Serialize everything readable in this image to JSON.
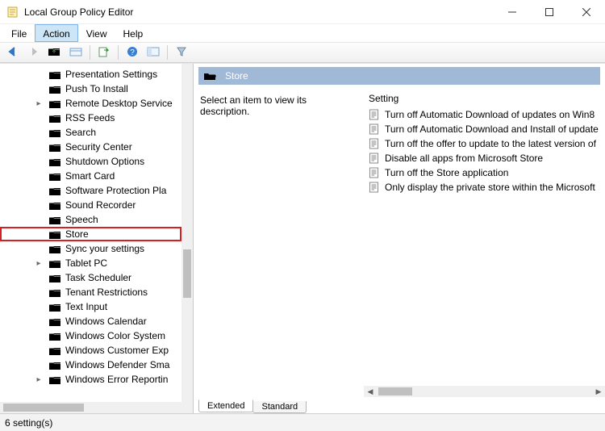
{
  "window": {
    "title": "Local Group Policy Editor"
  },
  "menubar": {
    "items": [
      "File",
      "Action",
      "View",
      "Help"
    ],
    "active_index": 1
  },
  "toolbar": {
    "icons": [
      "nav-back",
      "nav-forward",
      "up-folder",
      "properties",
      "sep",
      "export",
      "sep",
      "help",
      "show-hide",
      "sep",
      "filter"
    ]
  },
  "tree": {
    "items": [
      {
        "label": "Presentation Settings"
      },
      {
        "label": "Push To Install"
      },
      {
        "label": "Remote Desktop Service",
        "has_children": true
      },
      {
        "label": "RSS Feeds"
      },
      {
        "label": "Search"
      },
      {
        "label": "Security Center"
      },
      {
        "label": "Shutdown Options"
      },
      {
        "label": "Smart Card"
      },
      {
        "label": "Software Protection Pla"
      },
      {
        "label": "Sound Recorder"
      },
      {
        "label": "Speech"
      },
      {
        "label": "Store",
        "selected": true
      },
      {
        "label": "Sync your settings"
      },
      {
        "label": "Tablet PC",
        "has_children": true
      },
      {
        "label": "Task Scheduler"
      },
      {
        "label": "Tenant Restrictions"
      },
      {
        "label": "Text Input"
      },
      {
        "label": "Windows Calendar"
      },
      {
        "label": "Windows Color System"
      },
      {
        "label": "Windows Customer Exp"
      },
      {
        "label": "Windows Defender Sma"
      },
      {
        "label": "Windows Error Reportin",
        "has_children": true
      }
    ]
  },
  "detail": {
    "header": "Store",
    "hint": "Select an item to view its description.",
    "column": "Setting",
    "settings": [
      "Turn off Automatic Download of updates on Win8",
      "Turn off Automatic Download and Install of update",
      "Turn off the offer to update to the latest version of",
      "Disable all apps from Microsoft Store",
      "Turn off the Store application",
      "Only display the private store within the Microsoft"
    ]
  },
  "tabs": {
    "items": [
      "Extended",
      "Standard"
    ],
    "active_index": 0
  },
  "statusbar": {
    "text": "6 setting(s)"
  }
}
